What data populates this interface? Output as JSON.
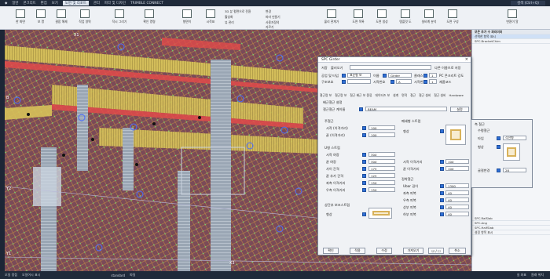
{
  "menu": {
    "items": [
      {
        "label": "일반"
      },
      {
        "label": "콘크리트"
      },
      {
        "label": "편집"
      },
      {
        "label": "보기"
      },
      {
        "label": "도면 및 리포트"
      },
      {
        "label": "관리"
      },
      {
        "label": "파라 및 디자인"
      },
      {
        "label": "TRIMBLE CONNECT"
      }
    ],
    "search_placeholder": "검색 (Ctrl+Q)"
  },
  "ribbon": {
    "buttons": [
      {
        "label": "한 화면"
      },
      {
        "label": "보 명"
      },
      {
        "label": "결합 해제"
      },
      {
        "label": "작업 영역"
      },
      {
        "label": "작시 그리기"
      },
      {
        "label": "확인 명령"
      },
      {
        "label": "형면이"
      },
      {
        "label": "시작표"
      }
    ],
    "small_items": [
      "3D 뷰 평면으로 전환",
      "활성화",
      "뷰 관리",
      "변경",
      "파라 만들기",
      "사용자정의",
      "자르기"
    ],
    "right_buttons": [
      {
        "label": "물리 관계가"
      },
      {
        "label": "도면 목록"
      },
      {
        "label": "도면 생성"
      },
      {
        "label": "템플릿 도"
      },
      {
        "label": "설비계 분석"
      },
      {
        "label": "도면 구성"
      },
      {
        "label": "변환이 알"
      }
    ]
  },
  "viewport": {
    "axis_labels": [
      "X1",
      "Y2",
      "Y1",
      "X3",
      "B",
      "C"
    ]
  },
  "right_panel": {
    "header": "모든 추가 수 파라미터",
    "items": [
      "선택한 항목 표시",
      "SPC.BracketChim",
      "SPC.RalSlab",
      "SPC.Ang",
      "SPC.HalfSlab",
      "설정 항목 표시"
    ]
  },
  "dialog": {
    "title": "SPC Girder",
    "row1": {
      "save_label": "저장",
      "load_label": "불러오기",
      "select_placeholder": "",
      "other_label": "다른 이름으로 저장",
      "std": "standard"
    },
    "row2": {
      "label1": "공업 및 타입",
      "field1": "표준형 보",
      "label2": "이름",
      "field2": "Girder",
      "label3": "클래스",
      "field3": "1",
      "label4": "PC 콘크리트 강도",
      "field4": "C30"
    },
    "row3": {
      "label1": "구조보호",
      "field1": "",
      "label2": "시작번호",
      "field2": "A",
      "label3": "시작번호",
      "field3": "1",
      "label4": "재품코드",
      "field4": ""
    },
    "tabs": [
      "철근량 보",
      "철근량 보",
      "철근 배근 보 종류",
      "데이터즈 보",
      "설계",
      "면적",
      "철근",
      "철근 설비",
      "철근 설비",
      "Hardware"
    ],
    "section_title": "배근철근 설정",
    "select_label": "철근철근 계이름",
    "select_value": "BEAM",
    "select_button": "설정",
    "main_rebar": {
      "title": "주철근",
      "rows": [
        {
          "label": "시작 (이격거리)",
          "value": "100"
        },
        {
          "label": "끝 (이격거리)",
          "value": "100"
        }
      ]
    },
    "stirrup": {
      "title": "U형 스트럽",
      "rows": [
        {
          "label": "시작 여장",
          "value": "300"
        },
        {
          "label": "끝 여장",
          "value": "300"
        },
        {
          "label": "사이 간격",
          "value": "175"
        },
        {
          "label": "끝 추가 간격",
          "value": "125"
        },
        {
          "label": "좌측 이격거리",
          "value": "150"
        },
        {
          "label": "우측 이격거리",
          "value": "150"
        }
      ]
    },
    "upper_rebar": {
      "title": "상단부 보조스트럽",
      "row_label": "형상"
    },
    "closed_stirrup": {
      "title": "폐쇄형 스트럽",
      "shape_label": "형상",
      "rows": [
        {
          "label": "시작 이격거리",
          "value": "100"
        },
        {
          "label": "끝 이격거리",
          "value": "100"
        }
      ]
    },
    "anchor": {
      "title": "정착철근",
      "rows": [
        {
          "label": "Ubar 길이",
          "value": "1300"
        },
        {
          "label": "좌측 피복",
          "value": "40"
        },
        {
          "label": "우측 피복",
          "value": "40"
        },
        {
          "label": "상부 피복",
          "value": "40"
        },
        {
          "label": "하부 피복",
          "value": "40"
        }
      ]
    },
    "side_rebar": {
      "title": "측 철근",
      "sub_title": "수평철근",
      "rows": [
        {
          "label": "타입",
          "value": "각선형"
        },
        {
          "label": "형상",
          "value": ""
        },
        {
          "label": "골절반경",
          "value": "28"
        }
      ]
    },
    "buttons": {
      "ok": "확인",
      "apply": "적용",
      "modify": "수정",
      "get": "가져오기",
      "check": "",
      "cancel": "취소"
    }
  },
  "statusbar": {
    "items": [
      "오일 정점",
      "오일어시 표시",
      "standard",
      "파일",
      "실 좌표",
      "원래 위치"
    ]
  }
}
